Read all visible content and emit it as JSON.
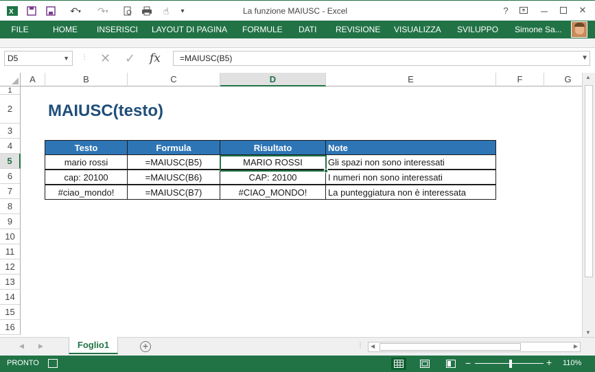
{
  "window": {
    "title": "La funzione MAIUSC - Excel",
    "help": "?",
    "user": "Simone Sa...",
    "accent": "#217346"
  },
  "ribbon": {
    "tabs": [
      "FILE",
      "HOME",
      "INSERISCI",
      "LAYOUT DI PAGINA",
      "FORMULE",
      "DATI",
      "REVISIONE",
      "VISUALIZZA",
      "SVILUPPO"
    ]
  },
  "formula_bar": {
    "name_box": "D5",
    "fx": "fx",
    "formula": "=MAIUSC(B5)"
  },
  "grid": {
    "columns": [
      "A",
      "B",
      "C",
      "D",
      "E",
      "F",
      "G"
    ],
    "selected_column": "D",
    "rows": [
      "1",
      "2",
      "3",
      "4",
      "5",
      "6",
      "7",
      "8",
      "9",
      "10",
      "11",
      "12",
      "13",
      "14",
      "15",
      "16"
    ],
    "selected_row": "5"
  },
  "sheet": {
    "heading": "MAIUSC(testo)",
    "table": {
      "headers": [
        "Testo",
        "Formula",
        "Risultato",
        "Note"
      ],
      "rows": [
        [
          "mario rossi",
          "=MAIUSC(B5)",
          "MARIO ROSSI",
          "Gli spazi non sono interessati"
        ],
        [
          "cap: 20100",
          "=MAIUSC(B6)",
          "CAP: 20100",
          "I numeri non sono interessati"
        ],
        [
          "#ciao_mondo!",
          "=MAIUSC(B7)",
          "#CIAO_MONDO!",
          "La punteggiatura non è interessata"
        ]
      ],
      "header_color": "#2e75b6"
    }
  },
  "sheet_tabs": {
    "active": "Foglio1",
    "add": "+"
  },
  "status_bar": {
    "status": "PRONTO",
    "zoom": "110%",
    "zoom_minus": "−",
    "zoom_plus": "+"
  }
}
